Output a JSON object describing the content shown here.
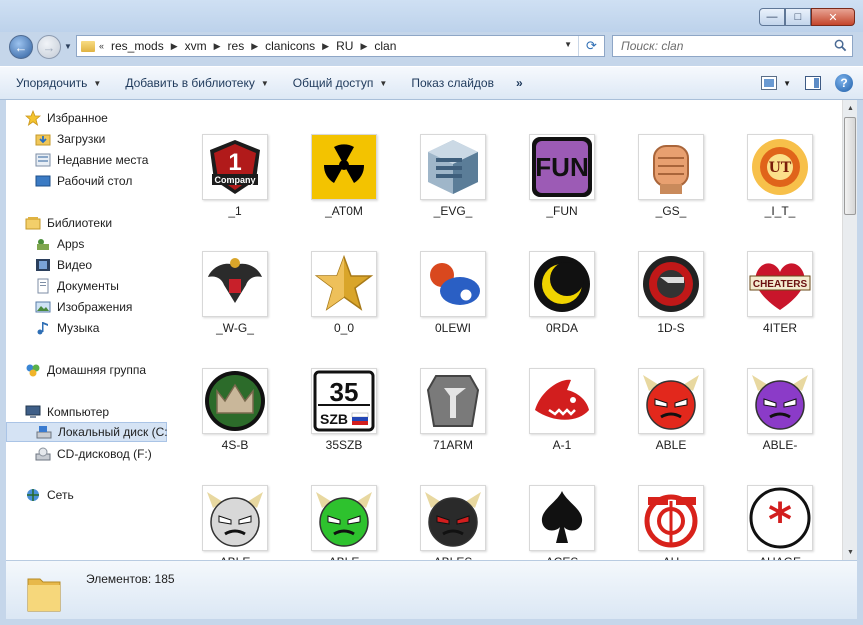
{
  "window": {
    "controls": {
      "minimize": "—",
      "maximize": "□",
      "close": "✕"
    }
  },
  "address": {
    "overflow": "«",
    "crumbs": [
      "res_mods",
      "xvm",
      "res",
      "clanicons",
      "RU",
      "clan"
    ],
    "search_placeholder": "Поиск: clan"
  },
  "toolbar": {
    "organize": "Упорядочить",
    "add_to_library": "Добавить в библиотеку",
    "share": "Общий доступ",
    "slideshow": "Показ слайдов",
    "more": "»"
  },
  "nav": {
    "favorites": "Избранное",
    "downloads": "Загрузки",
    "recent": "Недавние места",
    "desktop": "Рабочий стол",
    "libraries": "Библиотеки",
    "apps": "Apps",
    "video": "Видео",
    "documents": "Документы",
    "images": "Изображения",
    "music": "Музыка",
    "homegroup": "Домашняя группа",
    "computer": "Компьютер",
    "local_disk": "Локальный диск (C:",
    "cd_drive": "CD-дисковод (F:)",
    "network": "Сеть"
  },
  "files": [
    {
      "name": "_1",
      "icon": "1-company-shield",
      "color": "#b11a1a"
    },
    {
      "name": "_AT0M",
      "icon": "radiation",
      "color": "#f3c300"
    },
    {
      "name": "_EVG_",
      "icon": "cube-logo",
      "color": "#6a8ca6"
    },
    {
      "name": "_FUN",
      "icon": "fun-text",
      "color": "#9c5bb5",
      "text": "FUN"
    },
    {
      "name": "_GS_",
      "icon": "fist",
      "color": "#e8a070"
    },
    {
      "name": "_I_T_",
      "icon": "fire-emblem",
      "color": "#e0641a"
    },
    {
      "name": "_W-G_",
      "icon": "double-eagle",
      "color": "#2b2b2b"
    },
    {
      "name": "0_0",
      "icon": "gold-star",
      "color": "#d9a52a"
    },
    {
      "name": "0LEWI",
      "icon": "pacifier",
      "color": "#2a5fc4"
    },
    {
      "name": "0RDA",
      "icon": "crescent",
      "color": "#f0d400"
    },
    {
      "name": "1D-S",
      "icon": "red-swirl",
      "color": "#c11818"
    },
    {
      "name": "4ITER",
      "icon": "cheaters-heart",
      "color": "#c9152b",
      "text": "CHEATERS"
    },
    {
      "name": "4S-B",
      "icon": "crown",
      "color": "#2c6b2a"
    },
    {
      "name": "35SZB",
      "icon": "plate",
      "color": "#111111",
      "text": "35",
      "subtext": "SZB"
    },
    {
      "name": "71ARM",
      "icon": "metal-badge",
      "color": "#7a7a7a"
    },
    {
      "name": "A-1",
      "icon": "shark",
      "color": "#d21e1e"
    },
    {
      "name": "ABLE",
      "icon": "red-devil",
      "color": "#e2281c"
    },
    {
      "name": "ABLE-",
      "icon": "purple-devil",
      "color": "#8b3bc8"
    },
    {
      "name": "ABLE",
      "icon": "white-devil",
      "color": "#d8d8d8"
    },
    {
      "name": "ABLE",
      "icon": "green-devil",
      "color": "#2ec22e"
    },
    {
      "name": "ABLES",
      "icon": "black-devil",
      "color": "#2a2a2a"
    },
    {
      "name": "ACES",
      "icon": "spade",
      "color": "#111111"
    },
    {
      "name": "AH",
      "icon": "ah-emblem",
      "color": "#d8221b"
    },
    {
      "name": "AHAGE",
      "icon": "asterisk-circle",
      "color": "#d21e1e",
      "text": "*"
    }
  ],
  "status": {
    "count_text": "Элементов: 185"
  }
}
